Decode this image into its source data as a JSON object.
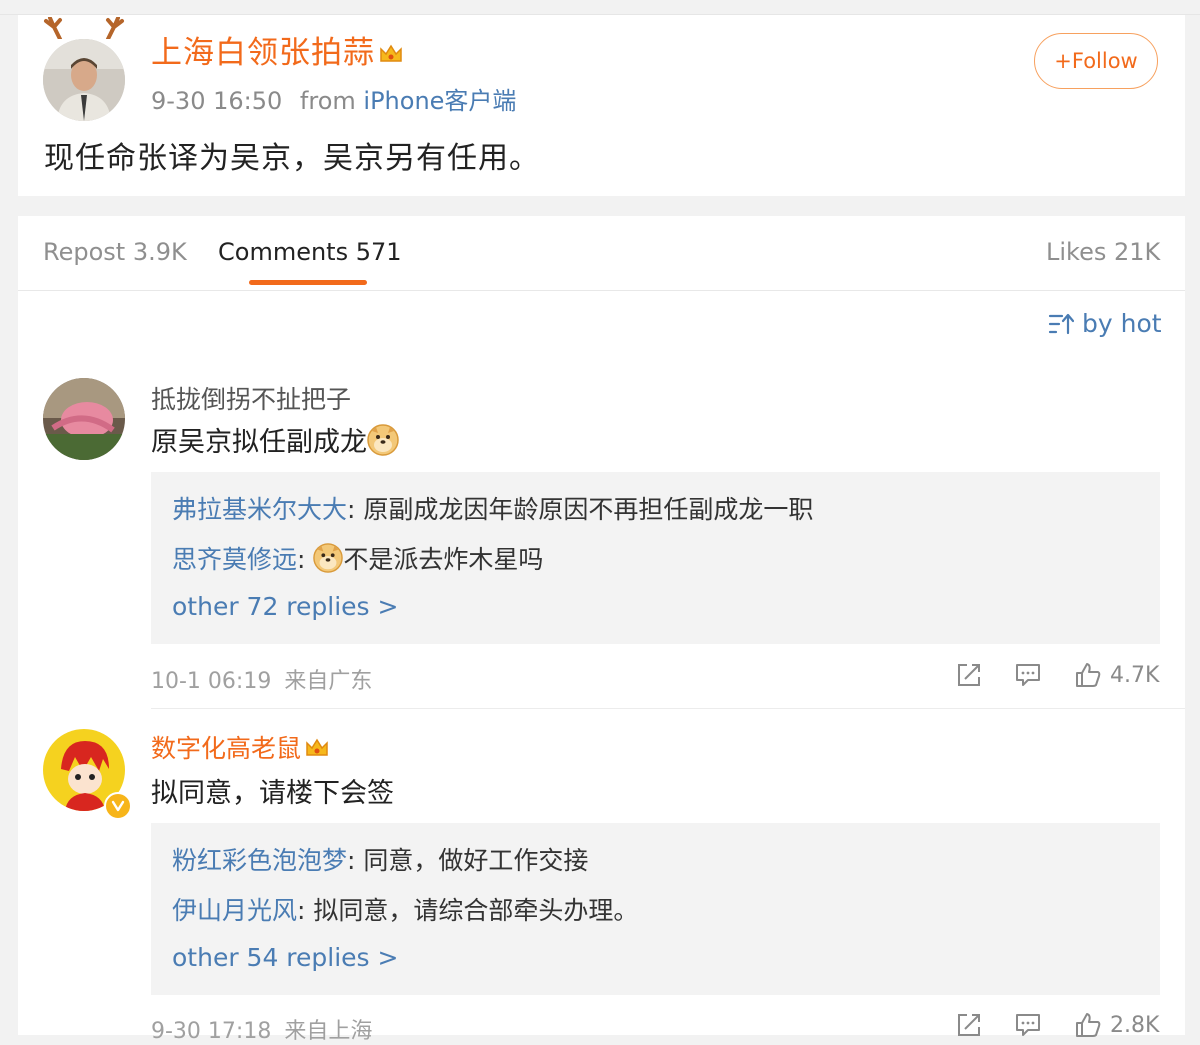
{
  "post": {
    "author": "上海白领张拍蒜",
    "time": "9-30 16:50",
    "from_label": "from",
    "source": "iPhone客户端",
    "follow_label": "+Follow",
    "text": "现任命张译为吴京，吴京另有任用。"
  },
  "tabs": {
    "repost": "Repost 3.9K",
    "comments": "Comments 571",
    "likes": "Likes 21K"
  },
  "sort_label": "by hot",
  "comments": [
    {
      "user": "抵拢倒拐不扯把子",
      "user_color": "#555555",
      "text": "原吴京拟任副成龙",
      "replies": [
        {
          "name": "弗拉基米尔大大",
          "text": ": 原副成龙因年龄原因不再担任副成龙一职"
        },
        {
          "name": "思齐莫修远",
          "text": "不是派去炸木星吗"
        }
      ],
      "more": "other 72 replies >",
      "time": "10-1 06:19",
      "location": "来自广东",
      "likes": "4.7K"
    },
    {
      "user": "数字化高老鼠",
      "user_color": "#f26a1b",
      "text": "拟同意，请楼下会签",
      "replies": [
        {
          "name": "粉红彩色泡泡梦",
          "text": ": 同意，做好工作交接"
        },
        {
          "name": "伊山月光风",
          "text": ": 拟同意，请综合部牵头办理。"
        }
      ],
      "more": "other 54 replies >",
      "time": "9-30 17:18",
      "location": "来自上海",
      "likes": "2.8K"
    }
  ],
  "colors": {
    "accent_orange": "#f26a1b",
    "link_blue": "#4a7cb3",
    "background": "#f2f2f2"
  },
  "icons": [
    "crown-badge-icon",
    "follow-plus-icon",
    "sort-icon",
    "doge-emoji-icon",
    "share-icon",
    "comment-icon",
    "thumbs-up-icon",
    "verified-badge-icon",
    "antler-decoration-icon"
  ]
}
